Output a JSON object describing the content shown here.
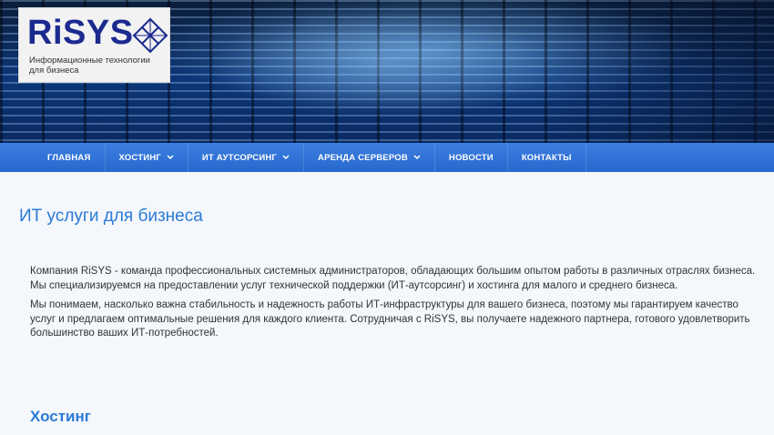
{
  "logo": {
    "brand": "RiSYS",
    "tagline": "Информационные технологии для бизнеса"
  },
  "nav": {
    "items": [
      {
        "label": "ГЛАВНАЯ"
      },
      {
        "label": "ХОСТИНГ"
      },
      {
        "label": "ИТ АУТСОРСИНГ"
      },
      {
        "label": "АРЕНДА СЕРВЕРОВ"
      },
      {
        "label": "НОВОСТИ"
      },
      {
        "label": "КОНТАКТЫ"
      }
    ]
  },
  "content": {
    "title": "ИТ услуги для бизнеса",
    "paragraph1": "Компания RiSYS - команда профессиональных системных администраторов, обладающих большим опытом работы в различных отраслях бизнеса. Мы специализируемся на предоставлении услуг технической поддержки (ИТ-аутсорсинг) и хостинга для малого и среднего бизнеса.",
    "paragraph2": "Мы понимаем, насколько важна стабильность и надежность работы ИТ-инфраструктуры для вашего бизнеса, поэтому мы гарантируем качество услуг и предлагаем оптимальные решения для каждого клиента. Сотрудничая с RiSYS, вы получаете надежного партнера, готового удовлетворить большинство ваших ИТ-потребностей.",
    "section_title": "Хостинг"
  },
  "icons": {
    "logo_mark": "diamond-grid-icon",
    "dropdown": "chevron-down-icon"
  },
  "colors": {
    "brand": "#1b2a8f",
    "nav": "#2f73d6",
    "heading": "#2a7ad8"
  }
}
